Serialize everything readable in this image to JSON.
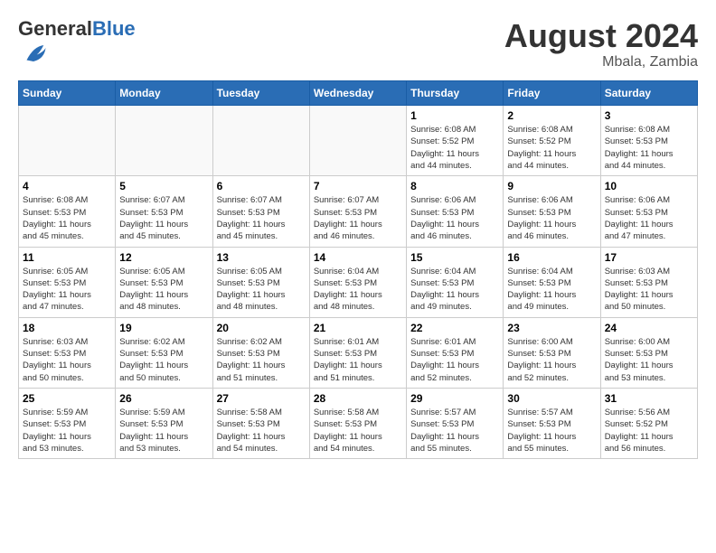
{
  "header": {
    "logo_general": "General",
    "logo_blue": "Blue",
    "month_title": "August 2024",
    "location": "Mbala, Zambia"
  },
  "weekdays": [
    "Sunday",
    "Monday",
    "Tuesday",
    "Wednesday",
    "Thursday",
    "Friday",
    "Saturday"
  ],
  "weeks": [
    [
      {
        "day": "",
        "info": ""
      },
      {
        "day": "",
        "info": ""
      },
      {
        "day": "",
        "info": ""
      },
      {
        "day": "",
        "info": ""
      },
      {
        "day": "1",
        "sunrise": "6:08 AM",
        "sunset": "5:52 PM",
        "daylight": "11 hours and 44 minutes."
      },
      {
        "day": "2",
        "sunrise": "6:08 AM",
        "sunset": "5:52 PM",
        "daylight": "11 hours and 44 minutes."
      },
      {
        "day": "3",
        "sunrise": "6:08 AM",
        "sunset": "5:53 PM",
        "daylight": "11 hours and 44 minutes."
      }
    ],
    [
      {
        "day": "4",
        "sunrise": "6:08 AM",
        "sunset": "5:53 PM",
        "daylight": "11 hours and 45 minutes."
      },
      {
        "day": "5",
        "sunrise": "6:07 AM",
        "sunset": "5:53 PM",
        "daylight": "11 hours and 45 minutes."
      },
      {
        "day": "6",
        "sunrise": "6:07 AM",
        "sunset": "5:53 PM",
        "daylight": "11 hours and 45 minutes."
      },
      {
        "day": "7",
        "sunrise": "6:07 AM",
        "sunset": "5:53 PM",
        "daylight": "11 hours and 46 minutes."
      },
      {
        "day": "8",
        "sunrise": "6:06 AM",
        "sunset": "5:53 PM",
        "daylight": "11 hours and 46 minutes."
      },
      {
        "day": "9",
        "sunrise": "6:06 AM",
        "sunset": "5:53 PM",
        "daylight": "11 hours and 46 minutes."
      },
      {
        "day": "10",
        "sunrise": "6:06 AM",
        "sunset": "5:53 PM",
        "daylight": "11 hours and 47 minutes."
      }
    ],
    [
      {
        "day": "11",
        "sunrise": "6:05 AM",
        "sunset": "5:53 PM",
        "daylight": "11 hours and 47 minutes."
      },
      {
        "day": "12",
        "sunrise": "6:05 AM",
        "sunset": "5:53 PM",
        "daylight": "11 hours and 48 minutes."
      },
      {
        "day": "13",
        "sunrise": "6:05 AM",
        "sunset": "5:53 PM",
        "daylight": "11 hours and 48 minutes."
      },
      {
        "day": "14",
        "sunrise": "6:04 AM",
        "sunset": "5:53 PM",
        "daylight": "11 hours and 48 minutes."
      },
      {
        "day": "15",
        "sunrise": "6:04 AM",
        "sunset": "5:53 PM",
        "daylight": "11 hours and 49 minutes."
      },
      {
        "day": "16",
        "sunrise": "6:04 AM",
        "sunset": "5:53 PM",
        "daylight": "11 hours and 49 minutes."
      },
      {
        "day": "17",
        "sunrise": "6:03 AM",
        "sunset": "5:53 PM",
        "daylight": "11 hours and 50 minutes."
      }
    ],
    [
      {
        "day": "18",
        "sunrise": "6:03 AM",
        "sunset": "5:53 PM",
        "daylight": "11 hours and 50 minutes."
      },
      {
        "day": "19",
        "sunrise": "6:02 AM",
        "sunset": "5:53 PM",
        "daylight": "11 hours and 50 minutes."
      },
      {
        "day": "20",
        "sunrise": "6:02 AM",
        "sunset": "5:53 PM",
        "daylight": "11 hours and 51 minutes."
      },
      {
        "day": "21",
        "sunrise": "6:01 AM",
        "sunset": "5:53 PM",
        "daylight": "11 hours and 51 minutes."
      },
      {
        "day": "22",
        "sunrise": "6:01 AM",
        "sunset": "5:53 PM",
        "daylight": "11 hours and 52 minutes."
      },
      {
        "day": "23",
        "sunrise": "6:00 AM",
        "sunset": "5:53 PM",
        "daylight": "11 hours and 52 minutes."
      },
      {
        "day": "24",
        "sunrise": "6:00 AM",
        "sunset": "5:53 PM",
        "daylight": "11 hours and 53 minutes."
      }
    ],
    [
      {
        "day": "25",
        "sunrise": "5:59 AM",
        "sunset": "5:53 PM",
        "daylight": "11 hours and 53 minutes."
      },
      {
        "day": "26",
        "sunrise": "5:59 AM",
        "sunset": "5:53 PM",
        "daylight": "11 hours and 53 minutes."
      },
      {
        "day": "27",
        "sunrise": "5:58 AM",
        "sunset": "5:53 PM",
        "daylight": "11 hours and 54 minutes."
      },
      {
        "day": "28",
        "sunrise": "5:58 AM",
        "sunset": "5:53 PM",
        "daylight": "11 hours and 54 minutes."
      },
      {
        "day": "29",
        "sunrise": "5:57 AM",
        "sunset": "5:53 PM",
        "daylight": "11 hours and 55 minutes."
      },
      {
        "day": "30",
        "sunrise": "5:57 AM",
        "sunset": "5:53 PM",
        "daylight": "11 hours and 55 minutes."
      },
      {
        "day": "31",
        "sunrise": "5:56 AM",
        "sunset": "5:52 PM",
        "daylight": "11 hours and 56 minutes."
      }
    ]
  ],
  "labels": {
    "sunrise": "Sunrise:",
    "sunset": "Sunset:",
    "daylight": "Daylight:"
  }
}
